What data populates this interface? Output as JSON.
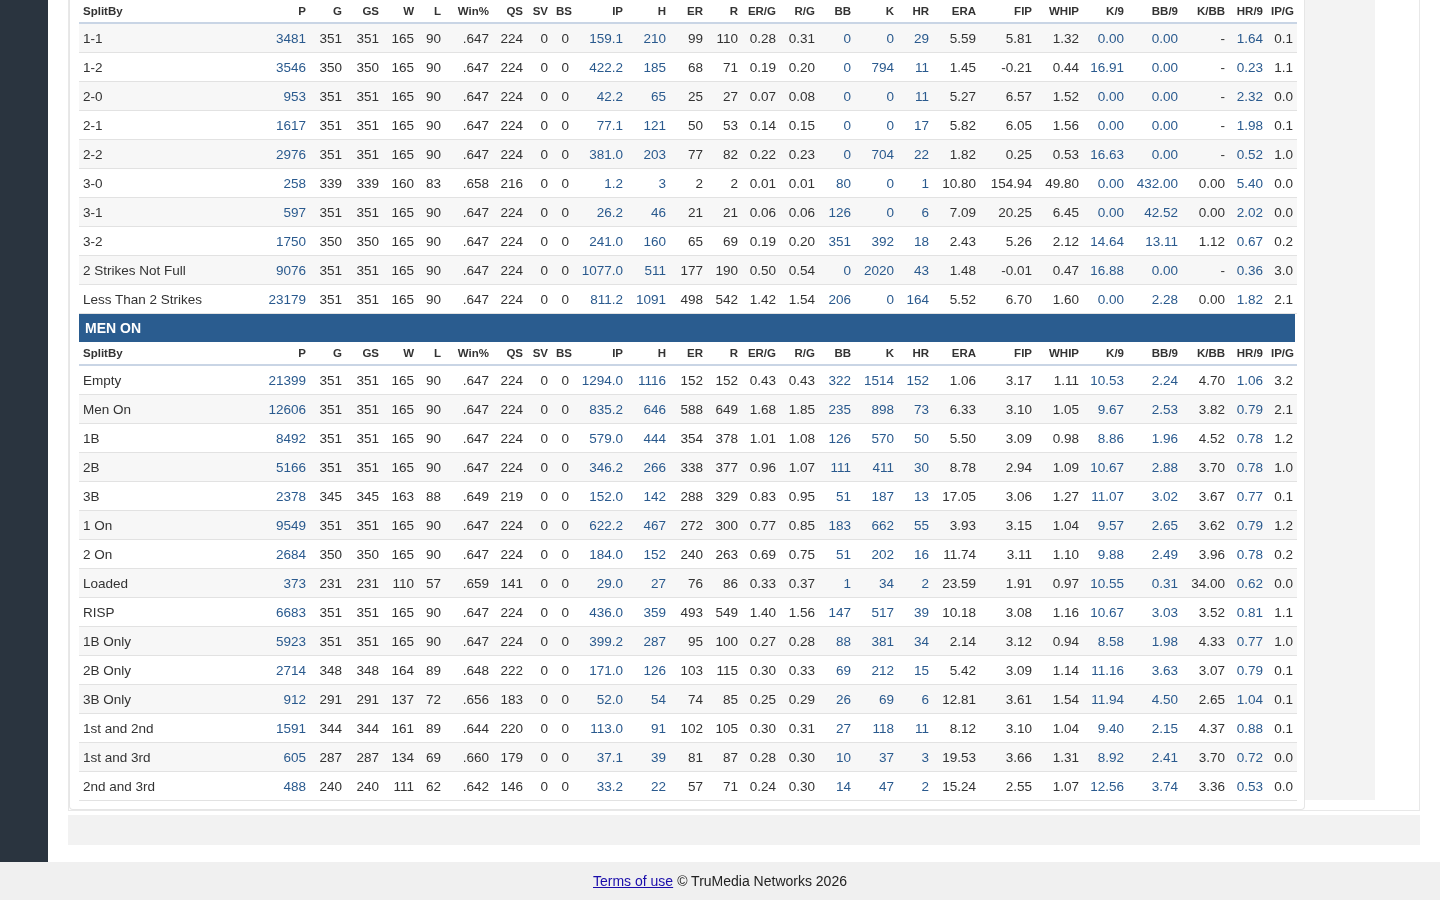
{
  "sections": [
    {
      "columns": [
        {
          "label": "SplitBy",
          "link": false
        },
        {
          "label": "P",
          "link": true
        },
        {
          "label": "G",
          "link": false
        },
        {
          "label": "GS",
          "link": false
        },
        {
          "label": "W",
          "link": false
        },
        {
          "label": "L",
          "link": false
        },
        {
          "label": "Win%",
          "link": false
        },
        {
          "label": "QS",
          "link": false
        },
        {
          "label": "SV",
          "link": false
        },
        {
          "label": "BS",
          "link": false
        },
        {
          "label": "IP",
          "link": true
        },
        {
          "label": "H",
          "link": true
        },
        {
          "label": "ER",
          "link": false
        },
        {
          "label": "R",
          "link": false
        },
        {
          "label": "ER/G",
          "link": false
        },
        {
          "label": "R/G",
          "link": false
        },
        {
          "label": "BB",
          "link": true
        },
        {
          "label": "K",
          "link": true
        },
        {
          "label": "HR",
          "link": true
        },
        {
          "label": "ERA",
          "link": false
        },
        {
          "label": "FIP",
          "link": false
        },
        {
          "label": "WHIP",
          "link": false
        },
        {
          "label": "K/9",
          "link": true
        },
        {
          "label": "BB/9",
          "link": true
        },
        {
          "label": "K/BB",
          "link": false
        },
        {
          "label": "HR/9",
          "link": true
        },
        {
          "label": "IP/G",
          "link": false
        }
      ],
      "rows": [
        {
          "cells": [
            "1-1",
            "3481",
            "351",
            "351",
            "165",
            "90",
            ".647",
            "224",
            "0",
            "0",
            "159.1",
            "210",
            "99",
            "110",
            "0.28",
            "0.31",
            "0",
            "0",
            "29",
            "5.59",
            "5.81",
            "1.32",
            "0.00",
            "0.00",
            "-",
            "1.64",
            "0.1"
          ]
        },
        {
          "cells": [
            "1-2",
            "3546",
            "350",
            "350",
            "165",
            "90",
            ".647",
            "224",
            "0",
            "0",
            "422.2",
            "185",
            "68",
            "71",
            "0.19",
            "0.20",
            "0",
            "794",
            "11",
            "1.45",
            "-0.21",
            "0.44",
            "16.91",
            "0.00",
            "-",
            "0.23",
            "1.1"
          ]
        },
        {
          "cells": [
            "2-0",
            "953",
            "351",
            "351",
            "165",
            "90",
            ".647",
            "224",
            "0",
            "0",
            "42.2",
            "65",
            "25",
            "27",
            "0.07",
            "0.08",
            "0",
            "0",
            "11",
            "5.27",
            "6.57",
            "1.52",
            "0.00",
            "0.00",
            "-",
            "2.32",
            "0.0"
          ]
        },
        {
          "cells": [
            "2-1",
            "1617",
            "351",
            "351",
            "165",
            "90",
            ".647",
            "224",
            "0",
            "0",
            "77.1",
            "121",
            "50",
            "53",
            "0.14",
            "0.15",
            "0",
            "0",
            "17",
            "5.82",
            "6.05",
            "1.56",
            "0.00",
            "0.00",
            "-",
            "1.98",
            "0.1"
          ]
        },
        {
          "cells": [
            "2-2",
            "2976",
            "351",
            "351",
            "165",
            "90",
            ".647",
            "224",
            "0",
            "0",
            "381.0",
            "203",
            "77",
            "82",
            "0.22",
            "0.23",
            "0",
            "704",
            "22",
            "1.82",
            "0.25",
            "0.53",
            "16.63",
            "0.00",
            "-",
            "0.52",
            "1.0"
          ]
        },
        {
          "cells": [
            "3-0",
            "258",
            "339",
            "339",
            "160",
            "83",
            ".658",
            "216",
            "0",
            "0",
            "1.2",
            "3",
            "2",
            "2",
            "0.01",
            "0.01",
            "80",
            "0",
            "1",
            "10.80",
            "154.94",
            "49.80",
            "0.00",
            "432.00",
            "0.00",
            "5.40",
            "0.0"
          ]
        },
        {
          "cells": [
            "3-1",
            "597",
            "351",
            "351",
            "165",
            "90",
            ".647",
            "224",
            "0",
            "0",
            "26.2",
            "46",
            "21",
            "21",
            "0.06",
            "0.06",
            "126",
            "0",
            "6",
            "7.09",
            "20.25",
            "6.45",
            "0.00",
            "42.52",
            "0.00",
            "2.02",
            "0.0"
          ]
        },
        {
          "cells": [
            "3-2",
            "1750",
            "350",
            "350",
            "165",
            "90",
            ".647",
            "224",
            "0",
            "0",
            "241.0",
            "160",
            "65",
            "69",
            "0.19",
            "0.20",
            "351",
            "392",
            "18",
            "2.43",
            "5.26",
            "2.12",
            "14.64",
            "13.11",
            "1.12",
            "0.67",
            "0.2"
          ]
        },
        {
          "cells": [
            "2 Strikes Not Full",
            "9076",
            "351",
            "351",
            "165",
            "90",
            ".647",
            "224",
            "0",
            "0",
            "1077.0",
            "511",
            "177",
            "190",
            "0.50",
            "0.54",
            "0",
            "2020",
            "43",
            "1.48",
            "-0.01",
            "0.47",
            "16.88",
            "0.00",
            "-",
            "0.36",
            "3.0"
          ]
        },
        {
          "cells": [
            "Less Than 2 Strikes",
            "23179",
            "351",
            "351",
            "165",
            "90",
            ".647",
            "224",
            "0",
            "0",
            "811.2",
            "1091",
            "498",
            "542",
            "1.42",
            "1.54",
            "206",
            "0",
            "164",
            "5.52",
            "6.70",
            "1.60",
            "0.00",
            "2.28",
            "0.00",
            "1.82",
            "2.1"
          ]
        }
      ]
    },
    {
      "title": "MEN ON",
      "columns": [
        {
          "label": "SplitBy",
          "link": false
        },
        {
          "label": "P",
          "link": true
        },
        {
          "label": "G",
          "link": false
        },
        {
          "label": "GS",
          "link": false
        },
        {
          "label": "W",
          "link": false
        },
        {
          "label": "L",
          "link": false
        },
        {
          "label": "Win%",
          "link": false
        },
        {
          "label": "QS",
          "link": false
        },
        {
          "label": "SV",
          "link": false
        },
        {
          "label": "BS",
          "link": false
        },
        {
          "label": "IP",
          "link": true
        },
        {
          "label": "H",
          "link": true
        },
        {
          "label": "ER",
          "link": false
        },
        {
          "label": "R",
          "link": false
        },
        {
          "label": "ER/G",
          "link": false
        },
        {
          "label": "R/G",
          "link": false
        },
        {
          "label": "BB",
          "link": true
        },
        {
          "label": "K",
          "link": true
        },
        {
          "label": "HR",
          "link": true
        },
        {
          "label": "ERA",
          "link": false
        },
        {
          "label": "FIP",
          "link": false
        },
        {
          "label": "WHIP",
          "link": false
        },
        {
          "label": "K/9",
          "link": true
        },
        {
          "label": "BB/9",
          "link": true
        },
        {
          "label": "K/BB",
          "link": false
        },
        {
          "label": "HR/9",
          "link": true
        },
        {
          "label": "IP/G",
          "link": false
        }
      ],
      "rows": [
        {
          "cells": [
            "Empty",
            "21399",
            "351",
            "351",
            "165",
            "90",
            ".647",
            "224",
            "0",
            "0",
            "1294.0",
            "1116",
            "152",
            "152",
            "0.43",
            "0.43",
            "322",
            "1514",
            "152",
            "1.06",
            "3.17",
            "1.11",
            "10.53",
            "2.24",
            "4.70",
            "1.06",
            "3.2"
          ]
        },
        {
          "cells": [
            "Men On",
            "12606",
            "351",
            "351",
            "165",
            "90",
            ".647",
            "224",
            "0",
            "0",
            "835.2",
            "646",
            "588",
            "649",
            "1.68",
            "1.85",
            "235",
            "898",
            "73",
            "6.33",
            "3.10",
            "1.05",
            "9.67",
            "2.53",
            "3.82",
            "0.79",
            "2.1"
          ]
        },
        {
          "cells": [
            "1B",
            "8492",
            "351",
            "351",
            "165",
            "90",
            ".647",
            "224",
            "0",
            "0",
            "579.0",
            "444",
            "354",
            "378",
            "1.01",
            "1.08",
            "126",
            "570",
            "50",
            "5.50",
            "3.09",
            "0.98",
            "8.86",
            "1.96",
            "4.52",
            "0.78",
            "1.2"
          ]
        },
        {
          "cells": [
            "2B",
            "5166",
            "351",
            "351",
            "165",
            "90",
            ".647",
            "224",
            "0",
            "0",
            "346.2",
            "266",
            "338",
            "377",
            "0.96",
            "1.07",
            "111",
            "411",
            "30",
            "8.78",
            "2.94",
            "1.09",
            "10.67",
            "2.88",
            "3.70",
            "0.78",
            "1.0"
          ]
        },
        {
          "cells": [
            "3B",
            "2378",
            "345",
            "345",
            "163",
            "88",
            ".649",
            "219",
            "0",
            "0",
            "152.0",
            "142",
            "288",
            "329",
            "0.83",
            "0.95",
            "51",
            "187",
            "13",
            "17.05",
            "3.06",
            "1.27",
            "11.07",
            "3.02",
            "3.67",
            "0.77",
            "0.1"
          ]
        },
        {
          "cells": [
            "1 On",
            "9549",
            "351",
            "351",
            "165",
            "90",
            ".647",
            "224",
            "0",
            "0",
            "622.2",
            "467",
            "272",
            "300",
            "0.77",
            "0.85",
            "183",
            "662",
            "55",
            "3.93",
            "3.15",
            "1.04",
            "9.57",
            "2.65",
            "3.62",
            "0.79",
            "1.2"
          ]
        },
        {
          "cells": [
            "2 On",
            "2684",
            "350",
            "350",
            "165",
            "90",
            ".647",
            "224",
            "0",
            "0",
            "184.0",
            "152",
            "240",
            "263",
            "0.69",
            "0.75",
            "51",
            "202",
            "16",
            "11.74",
            "3.11",
            "1.10",
            "9.88",
            "2.49",
            "3.96",
            "0.78",
            "0.2"
          ]
        },
        {
          "cells": [
            "Loaded",
            "373",
            "231",
            "231",
            "110",
            "57",
            ".659",
            "141",
            "0",
            "0",
            "29.0",
            "27",
            "76",
            "86",
            "0.33",
            "0.37",
            "1",
            "34",
            "2",
            "23.59",
            "1.91",
            "0.97",
            "10.55",
            "0.31",
            "34.00",
            "0.62",
            "0.0"
          ]
        },
        {
          "cells": [
            "RISP",
            "6683",
            "351",
            "351",
            "165",
            "90",
            ".647",
            "224",
            "0",
            "0",
            "436.0",
            "359",
            "493",
            "549",
            "1.40",
            "1.56",
            "147",
            "517",
            "39",
            "10.18",
            "3.08",
            "1.16",
            "10.67",
            "3.03",
            "3.52",
            "0.81",
            "1.1"
          ]
        },
        {
          "cells": [
            "1B Only",
            "5923",
            "351",
            "351",
            "165",
            "90",
            ".647",
            "224",
            "0",
            "0",
            "399.2",
            "287",
            "95",
            "100",
            "0.27",
            "0.28",
            "88",
            "381",
            "34",
            "2.14",
            "3.12",
            "0.94",
            "8.58",
            "1.98",
            "4.33",
            "0.77",
            "1.0"
          ]
        },
        {
          "cells": [
            "2B Only",
            "2714",
            "348",
            "348",
            "164",
            "89",
            ".648",
            "222",
            "0",
            "0",
            "171.0",
            "126",
            "103",
            "115",
            "0.30",
            "0.33",
            "69",
            "212",
            "15",
            "5.42",
            "3.09",
            "1.14",
            "11.16",
            "3.63",
            "3.07",
            "0.79",
            "0.1"
          ]
        },
        {
          "cells": [
            "3B Only",
            "912",
            "291",
            "291",
            "137",
            "72",
            ".656",
            "183",
            "0",
            "0",
            "52.0",
            "54",
            "74",
            "85",
            "0.25",
            "0.29",
            "26",
            "69",
            "6",
            "12.81",
            "3.61",
            "1.54",
            "11.94",
            "4.50",
            "2.65",
            "1.04",
            "0.1"
          ]
        },
        {
          "cells": [
            "1st and 2nd",
            "1591",
            "344",
            "344",
            "161",
            "89",
            ".644",
            "220",
            "0",
            "0",
            "113.0",
            "91",
            "102",
            "105",
            "0.30",
            "0.31",
            "27",
            "118",
            "11",
            "8.12",
            "3.10",
            "1.04",
            "9.40",
            "2.15",
            "4.37",
            "0.88",
            "0.1"
          ]
        },
        {
          "cells": [
            "1st and 3rd",
            "605",
            "287",
            "287",
            "134",
            "69",
            ".660",
            "179",
            "0",
            "0",
            "37.1",
            "39",
            "81",
            "87",
            "0.28",
            "0.30",
            "10",
            "37",
            "3",
            "19.53",
            "3.66",
            "1.31",
            "8.92",
            "2.41",
            "3.70",
            "0.72",
            "0.0"
          ]
        },
        {
          "cells": [
            "2nd and 3rd",
            "488",
            "240",
            "240",
            "111",
            "62",
            ".642",
            "146",
            "0",
            "0",
            "33.2",
            "22",
            "57",
            "71",
            "0.24",
            "0.30",
            "14",
            "47",
            "2",
            "15.24",
            "2.55",
            "1.07",
            "12.56",
            "3.74",
            "3.36",
            "0.53",
            "0.0"
          ]
        }
      ]
    }
  ],
  "footer": {
    "link": "Terms of use",
    "text": "© TruMedia Networks 2026"
  }
}
